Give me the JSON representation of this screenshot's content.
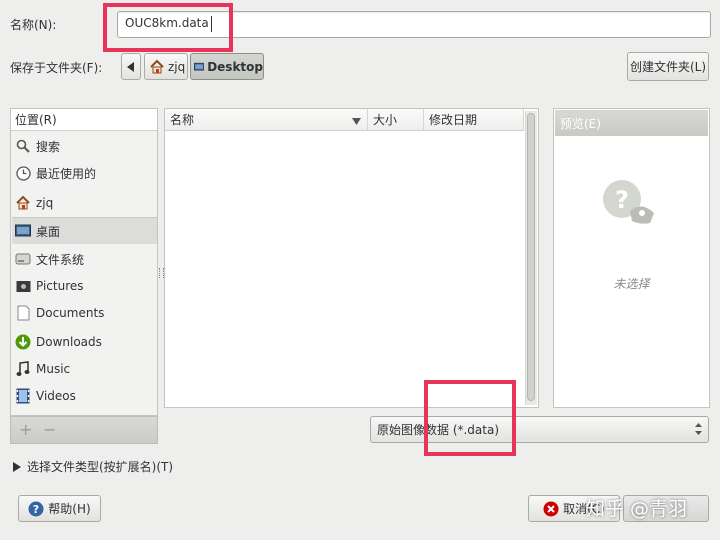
{
  "name_row": {
    "label": "名称(N):",
    "value": "OUC8km.data"
  },
  "save_in": {
    "label": "保存于文件夹(F):",
    "crumbs": [
      "zjq",
      "Desktop"
    ],
    "create_folder": "创建文件夹(L)"
  },
  "places": {
    "header": "位置(R)",
    "items": [
      {
        "label": "搜索",
        "icon": "search-icon"
      },
      {
        "label": "最近使用的",
        "icon": "recent-icon"
      },
      {
        "label": "zjq",
        "icon": "home-icon"
      },
      {
        "label": "桌面",
        "icon": "desktop-icon"
      },
      {
        "label": "文件系统",
        "icon": "drive-icon"
      },
      {
        "label": "Pictures",
        "icon": "camera-icon"
      },
      {
        "label": "Documents",
        "icon": "document-icon"
      },
      {
        "label": "Downloads",
        "icon": "download-icon"
      },
      {
        "label": "Music",
        "icon": "music-icon"
      },
      {
        "label": "Videos",
        "icon": "film-icon"
      }
    ],
    "add": "+",
    "remove": "−"
  },
  "file_list": {
    "columns": [
      "名称",
      "大小",
      "修改日期"
    ]
  },
  "preview": {
    "header": "预览(E)",
    "empty": "未选择"
  },
  "filter": {
    "value": "原始图像数据 (*.data)"
  },
  "file_type_expander": "选择文件类型(按扩展名)(T)",
  "buttons": {
    "help": "帮助(H)",
    "cancel": "取消(C)"
  },
  "watermark": "知乎 @青羽",
  "colors": {
    "highlight": "#e8345a",
    "selected": "#dcdcda"
  }
}
